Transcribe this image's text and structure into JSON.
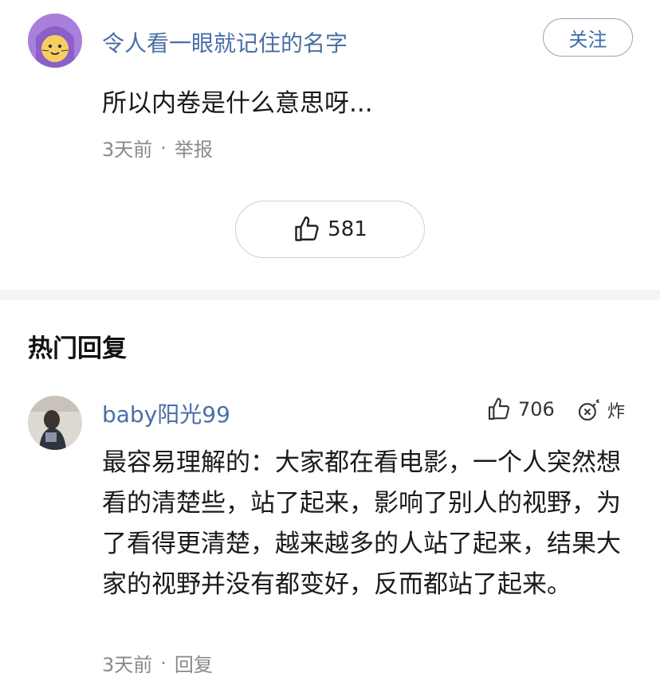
{
  "top_comment": {
    "avatar_icon": "cat-face-avatar",
    "username": "令人看一眼就记住的名字",
    "follow_label": "关注",
    "text": "所以内卷是什么意思呀...",
    "time": "3天前",
    "separator": "·",
    "report_label": "举报",
    "like_count": "581"
  },
  "hot_replies": {
    "section_title": "热门回复",
    "items": [
      {
        "avatar_icon": "person-photo-avatar",
        "username": "baby阳光99",
        "like_count": "706",
        "bomb_label": "炸",
        "text": "最容易理解的：大家都在看电影，一个人突然想看的清楚些，站了起来，影响了别人的视野，为了看得更清楚，越来越多的人站了起来，结果大家的视野并没有都变好，反而都站了起来。",
        "time": "3天前",
        "separator": "·",
        "reply_label": "回复"
      }
    ]
  },
  "colors": {
    "username": "#4a6fa5",
    "follow_text": "#3e6ea8",
    "meta": "#8a8a8a",
    "divider": "#f4f4f4"
  }
}
